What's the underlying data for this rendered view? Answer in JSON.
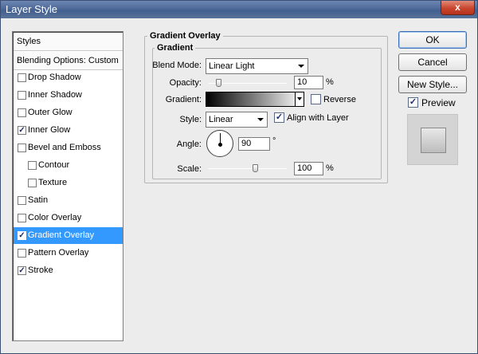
{
  "window": {
    "title": "Layer Style",
    "close_label": "x"
  },
  "styles_list": {
    "header": "Styles",
    "blending": "Blending Options: Custom",
    "items": [
      {
        "label": "Drop Shadow",
        "checked": false
      },
      {
        "label": "Inner Shadow",
        "checked": false
      },
      {
        "label": "Outer Glow",
        "checked": false
      },
      {
        "label": "Inner Glow",
        "checked": true
      },
      {
        "label": "Bevel and Emboss",
        "checked": false
      },
      {
        "label": "Contour",
        "checked": false,
        "indent": true
      },
      {
        "label": "Texture",
        "checked": false,
        "indent": true
      },
      {
        "label": "Satin",
        "checked": false
      },
      {
        "label": "Color Overlay",
        "checked": false
      },
      {
        "label": "Gradient Overlay",
        "checked": true,
        "selected": true
      },
      {
        "label": "Pattern Overlay",
        "checked": false
      },
      {
        "label": "Stroke",
        "checked": true
      }
    ]
  },
  "panel": {
    "title": "Gradient Overlay",
    "group_title": "Gradient",
    "blend_mode_label": "Blend Mode:",
    "blend_mode_value": "Linear Light",
    "opacity_label": "Opacity:",
    "opacity_value": "10",
    "opacity_unit": "%",
    "opacity_fraction": 0.1,
    "gradient_label": "Gradient:",
    "reverse_label": "Reverse",
    "reverse_checked": false,
    "style_label": "Style:",
    "style_value": "Linear",
    "align_label": "Align with Layer",
    "align_checked": true,
    "angle_label": "Angle:",
    "angle_value": "90",
    "angle_unit": "°",
    "scale_label": "Scale:",
    "scale_value": "100",
    "scale_unit": "%",
    "scale_fraction": 0.6
  },
  "actions": {
    "ok": "OK",
    "cancel": "Cancel",
    "new_style": "New Style...",
    "preview_label": "Preview",
    "preview_checked": true
  },
  "check_mark": "✓"
}
